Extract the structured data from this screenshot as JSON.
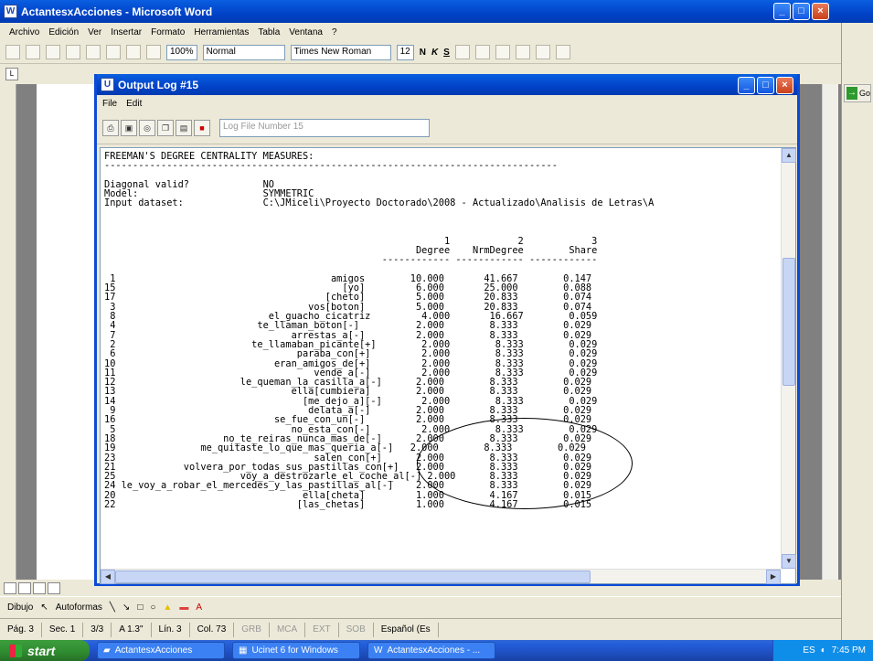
{
  "word": {
    "title": "ActantesxAcciones - Microsoft Word",
    "menu": [
      "Archivo",
      "Edición",
      "Ver",
      "Insertar",
      "Formato",
      "Herramientas",
      "Tabla",
      "Ventana",
      "?"
    ],
    "zoom": "100%",
    "style": "Normal",
    "font": "Times New Roman",
    "size": "12",
    "bold": "N",
    "italic": "K",
    "underline": "S",
    "go_label": "Go",
    "draw_label": "Dibujo",
    "autoshapes_label": "Autoformas",
    "status": {
      "page": "Pág. 3",
      "sec": "Sec. 1",
      "pages": "3/3",
      "at": "A 1.3\"",
      "line": "Lín. 3",
      "col": "Col. 73",
      "grb": "GRB",
      "mca": "MCA",
      "ext": "EXT",
      "sob": "SOB",
      "lang": "Español (Es"
    }
  },
  "ucinet": {
    "title": "Output Log #15",
    "menu": [
      "File",
      "Edit"
    ],
    "log_placeholder": "Log File Number 15",
    "log_lines": [
      "FREEMAN'S DEGREE CENTRALITY MEASURES:",
      "--------------------------------------------------------------------------------",
      "",
      "Diagonal valid?             NO",
      "Model:                      SYMMETRIC",
      "Input dataset:              C:\\JMiceli\\Proyecto Doctorado\\2008 - Actualizado\\Analisis de Letras\\A",
      "",
      "",
      "",
      "                                                            1            2            3",
      "                                                       Degree    NrmDegree        Share",
      "                                                 ------------ ------------ ------------",
      "",
      " 1                                      amigos        10.000       41.667        0.147",
      "15                                        [yo]         6.000       25.000        0.088",
      "17                                     [cheto]         5.000       20.833        0.074",
      " 3                                  vos[boton]         5.000       20.833        0.074",
      " 8                           el_guacho_cicatriz         4.000       16.667        0.059",
      " 4                         te_llaman_boton[-]          2.000        8.333        0.029",
      " 7                               arrestas_a[-]         2.000        8.333        0.029",
      " 2                        te_llamaban_picante[+]        2.000        8.333        0.029",
      " 6                                paraba_con[+]         2.000        8.333        0.029",
      "10                            eran_amigos_de[+]         2.000        8.333        0.029",
      "11                                   vende_a[-]         2.000        8.333        0.029",
      "12                      le_queman_la_casilla_a[-]      2.000        8.333        0.029",
      "13                               ella[cumbiera]        2.000        8.333        0.029",
      "14                                 [me_dejo_a][-]       2.000        8.333        0.029",
      " 9                                  delata_a[-]        2.000        8.333        0.029",
      "16                            se_fue_con_un[-]         2.000        8.333        0.029",
      " 5                               no_esta_con[-]         2.000        8.333        0.029",
      "18                   no_te_reiras_nunca_mas_de[-]      2.000        8.333        0.029",
      "19               me_quitaste_lo_que_mas_queria_a[-]   2.000        8.333        0.029",
      "23                                   salen_con[+]      2.000        8.333        0.029",
      "21            volvera_por_todas_sus_pastillas_con[+]   2.000        8.333        0.029",
      "25                      voy_a_destrozarle_el_coche_al[-] 2.000      8.333        0.029",
      "24 le_voy_a_robar_el_mercedes_y_las_pastillas_al[-]    2.000        8.333        0.029",
      "20                                 ella[cheta]         1.000        4.167        0.015",
      "22                                [las_chetas]         1.000        4.167        0.015"
    ]
  },
  "taskbar": {
    "start": "start",
    "tasks": [
      "ActantesxAcciones",
      "Ucinet 6 for Windows",
      "ActantesxAcciones - ..."
    ],
    "lang": "ES",
    "time": "7:45 PM"
  }
}
